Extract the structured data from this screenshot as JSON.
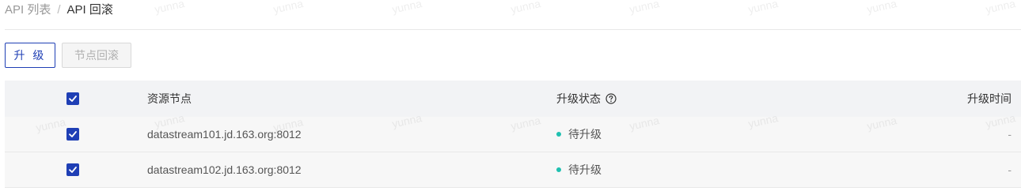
{
  "breadcrumb": {
    "parent": "API 列表",
    "separator": "/",
    "current": "API 回滚"
  },
  "toolbar": {
    "upgrade_label": "升 级",
    "rollback_label": "节点回滚"
  },
  "table": {
    "columns": {
      "node": "资源节点",
      "status": "升级状态",
      "time": "升级时间"
    },
    "rows": [
      {
        "node": "datastream101.jd.163.org:8012",
        "status": "待升级",
        "time": "-"
      },
      {
        "node": "datastream102.jd.163.org:8012",
        "status": "待升级",
        "time": "-"
      }
    ]
  },
  "watermark_text": "yunna",
  "colors": {
    "primary": "#1f3fb5",
    "status_dot": "#1fc0b0",
    "header_bg": "#f2f3f5"
  },
  "icons": {
    "checkbox": "checkbox-checked-icon",
    "help": "question-circle-icon"
  }
}
